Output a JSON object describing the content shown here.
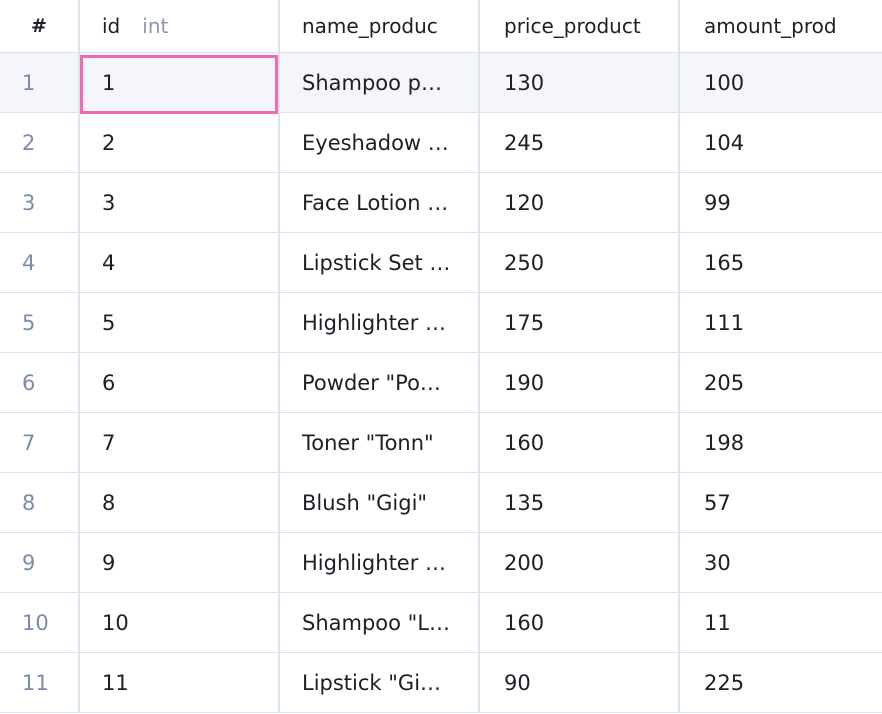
{
  "columns": {
    "index": "#",
    "id": "id",
    "id_type": "int",
    "name": "name_produc",
    "price": "price_product",
    "amount": "amount_prod"
  },
  "rows": [
    {
      "index": "1",
      "id": "1",
      "name": "Shampoo p…",
      "price": "130",
      "amount": "100"
    },
    {
      "index": "2",
      "id": "2",
      "name": "Eyeshadow …",
      "price": "245",
      "amount": "104"
    },
    {
      "index": "3",
      "id": "3",
      "name": "Face Lotion …",
      "price": "120",
      "amount": "99"
    },
    {
      "index": "4",
      "id": "4",
      "name": "Lipstick Set …",
      "price": "250",
      "amount": "165"
    },
    {
      "index": "5",
      "id": "5",
      "name": "Highlighter …",
      "price": "175",
      "amount": "111"
    },
    {
      "index": "6",
      "id": "6",
      "name": "Powder \"Po…",
      "price": "190",
      "amount": "205"
    },
    {
      "index": "7",
      "id": "7",
      "name": "Toner \"Tonn\"",
      "price": "160",
      "amount": "198"
    },
    {
      "index": "8",
      "id": "8",
      "name": "Blush \"Gigi\"",
      "price": "135",
      "amount": "57"
    },
    {
      "index": "9",
      "id": "9",
      "name": "Highlighter …",
      "price": "200",
      "amount": "30"
    },
    {
      "index": "10",
      "id": "10",
      "name": "Shampoo \"L…",
      "price": "160",
      "amount": "11"
    },
    {
      "index": "11",
      "id": "11",
      "name": "Lipstick \"Gi…",
      "price": "90",
      "amount": "225"
    }
  ],
  "colors": {
    "focus_border": "#f06ab4",
    "grid_line": "#dde3ee",
    "row_index_text": "#7d8bab",
    "type_label_text": "#8a96b3"
  }
}
